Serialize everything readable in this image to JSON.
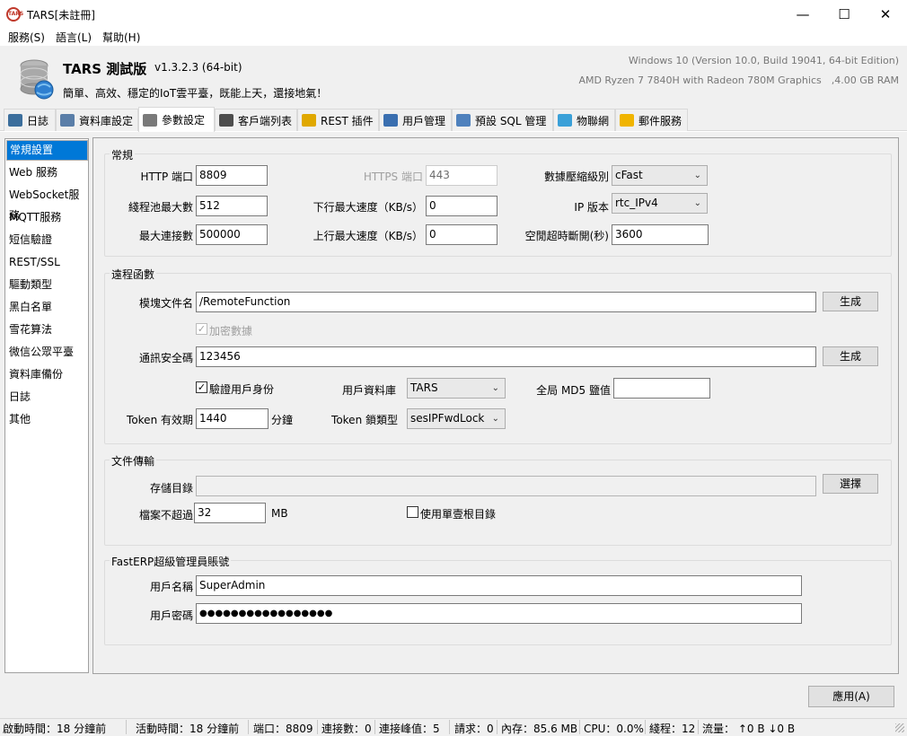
{
  "window": {
    "title": "TARS[未註冊]",
    "icon_text": "TARS"
  },
  "menu": [
    "服務(S)",
    "語言(L)",
    "幫助(H)"
  ],
  "header": {
    "app_name": "TARS 測試版",
    "version": "v1.3.2.3 (64-bit)",
    "tagline": "簡單、高效、穩定的IoT雲平臺，既能上天，還接地氣！",
    "os_info": "Windows 10 (Version 10.0, Build 19041, 64-bit Edition)",
    "hw_info": "AMD Ryzen 7 7840H with Radeon 780M Graphics　,4.00 GB RAM"
  },
  "tabs": [
    {
      "label": "日誌",
      "icon": "log-icon",
      "color": "#3b6e9c"
    },
    {
      "label": "資料庫設定",
      "icon": "database-settings-icon",
      "color": "#5a7ea8"
    },
    {
      "label": "參數設定",
      "icon": "tools-icon",
      "color": "#7a7a7a"
    },
    {
      "label": "客戶端列表",
      "icon": "monitor-icon",
      "color": "#4d4d4d"
    },
    {
      "label": "REST 插件",
      "icon": "puzzle-icon",
      "color": "#e0a800"
    },
    {
      "label": "用戶管理",
      "icon": "user-icon",
      "color": "#3a6fb0"
    },
    {
      "label": "預設 SQL 管理",
      "icon": "table-icon",
      "color": "#4f81bd"
    },
    {
      "label": "物聯網",
      "icon": "iot-icon",
      "color": "#3aa0d8"
    },
    {
      "label": "郵件服務",
      "icon": "mail-icon",
      "color": "#f0b400"
    }
  ],
  "sidebar": [
    "常規設置",
    "Web 服務",
    "WebSocket服務",
    "MQTT服務",
    "短信驗證",
    "REST/SSL",
    "驅動類型",
    "黑白名單",
    "雪花算法",
    "微信公眾平臺",
    "資料庫備份",
    "日誌",
    "其他"
  ],
  "general": {
    "title": "常規",
    "http_port_label": "HTTP 端口",
    "http_port": "8809",
    "https_port_label": "HTTPS 端口",
    "https_port": "443",
    "compress_label": "數據壓縮級別",
    "compress": "cFast",
    "pool_label": "綫程池最大數",
    "pool": "512",
    "down_label": "下行最大速度（KB/s）",
    "down": "0",
    "ip_label": "IP 版本",
    "ip": "rtc_IPv4",
    "maxconn_label": "最大連接數",
    "maxconn": "500000",
    "up_label": "上行最大速度（KB/s）",
    "up": "0",
    "idle_label": "空閒超時斷開(秒)",
    "idle": "3600"
  },
  "remote": {
    "title": "遠程函數",
    "module_label": "模塊文件名",
    "module": "/RemoteFunction",
    "gen1": "生成",
    "encrypt_label": "加密數據",
    "encrypt_checked": "✓",
    "secure_label": "通訊安全碼",
    "secure": "123456",
    "gen2": "生成",
    "verify_label": "驗證用戶身份",
    "verify_checked": "✓",
    "userdb_label": "用戶資料庫",
    "userdb": "TARS",
    "md5_label": "全局 MD5 鹽值",
    "md5": "",
    "token_label": "Token 有效期",
    "token": "1440",
    "token_unit": "分鐘",
    "lock_label": "Token 鎖類型",
    "lock": "sesIPFwdLock"
  },
  "transfer": {
    "title": "文件傳輸",
    "dir_label": "存儲目錄",
    "dir": "",
    "choose": "選擇",
    "size_label": "檔案不超過",
    "size": "32",
    "size_unit": "MB",
    "single_root_label": "使用單壹根目錄",
    "single_root_checked": ""
  },
  "admin": {
    "title": "FastERP超級管理員賬號",
    "user_label": "用戶名稱",
    "user": "SuperAdmin",
    "pass_label": "用戶密碼",
    "pass": "●●●●●●●●●●●●●●●●●"
  },
  "apply": "應用(A)",
  "status": {
    "start": "啟動時間：18 分鐘前",
    "active": "活動時間：18 分鐘前",
    "port": "端口：8809",
    "conn": "連接數：0",
    "peak": "連接峰值：5",
    "req": "請求：0",
    "mem": "內存：85.6 MB",
    "cpu": "CPU：0.0%",
    "threads": "綫程：12",
    "flow": "流量： ↑0 B ↓0 B"
  }
}
